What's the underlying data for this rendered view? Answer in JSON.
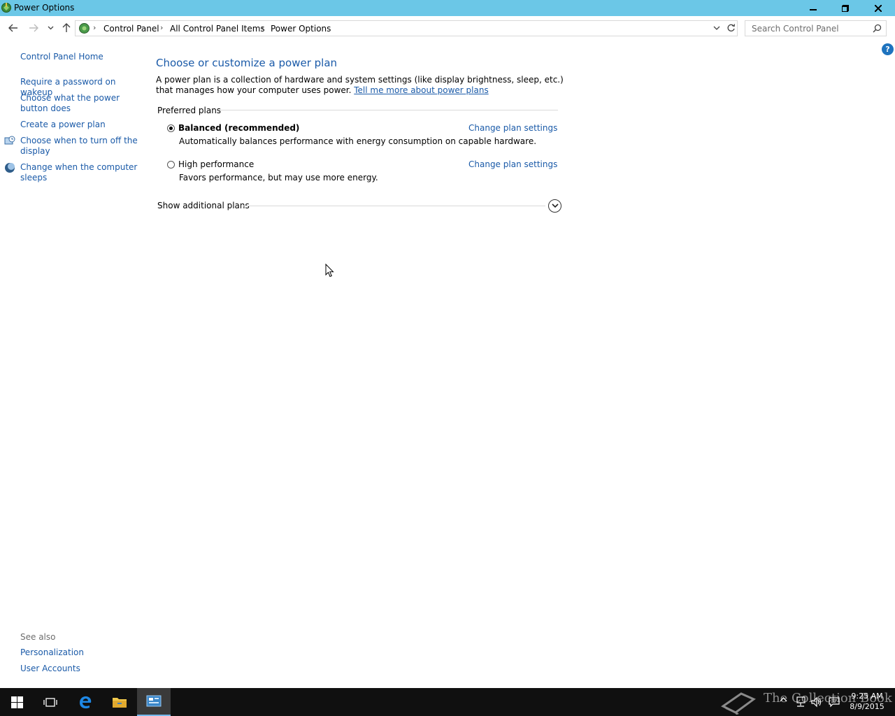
{
  "window": {
    "title": "Power Options"
  },
  "nav": {
    "breadcrumbs": [
      "Control Panel",
      "All Control Panel Items",
      "Power Options"
    ],
    "search_placeholder": "Search Control Panel"
  },
  "help": {
    "label": "?"
  },
  "left_pane": {
    "home": "Control Panel Home",
    "links": [
      "Require a password on wakeup",
      "Choose what the power button does",
      "Create a power plan",
      "Choose when to turn off the display",
      "Change when the computer sleeps"
    ],
    "see_also_label": "See also",
    "see_also": [
      "Personalization",
      "User Accounts"
    ]
  },
  "main": {
    "heading": "Choose or customize a power plan",
    "description": "A power plan is a collection of hardware and system settings (like display brightness, sleep, etc.) that manages how your computer uses power.",
    "tell_me_more": "Tell me more about power plans",
    "preferred_label": "Preferred plans",
    "plans": [
      {
        "name": "Balanced (recommended)",
        "description": "Automatically balances performance with energy consumption on capable hardware.",
        "selected": true,
        "action": "Change plan settings"
      },
      {
        "name": "High performance",
        "description": "Favors performance, but may use more energy.",
        "selected": false,
        "action": "Change plan settings"
      }
    ],
    "show_additional": "Show additional plans"
  },
  "taskbar": {
    "time": "9:25 AM",
    "date": "8/9/2015",
    "watermark": "The Collection Book"
  },
  "colors": {
    "titlebar": "#6bc7e7",
    "link": "#1a5aa8",
    "taskbar": "#101010"
  }
}
